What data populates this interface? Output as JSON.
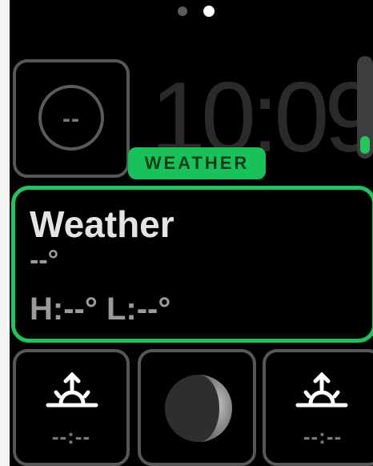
{
  "page_indicator": {
    "total": 2,
    "active_index": 1
  },
  "time": "10:09",
  "timer_complication": {
    "value": "--",
    "icon": "timer-ring-icon"
  },
  "selected_complication_label": "WEATHER",
  "weather": {
    "title": "Weather",
    "temperature": "--°",
    "high_low": "H:--° L:--°"
  },
  "bottom_complications": {
    "sunrise_time": "--:--",
    "sunset_time": "--:--",
    "moon_icon": "moon-phase-icon",
    "sunrise_icon": "sunrise-icon",
    "sunset_icon": "sunset-icon"
  },
  "colors": {
    "accent": "#1cc65a",
    "background": "#000000",
    "border_gray": "#575757"
  }
}
